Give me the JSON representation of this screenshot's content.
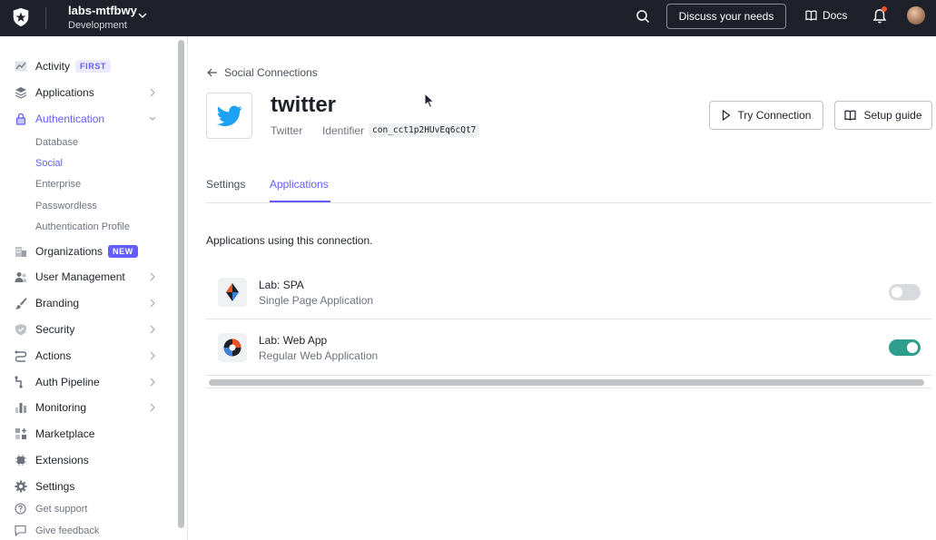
{
  "topbar": {
    "tenant_name": "labs-mtfbwy",
    "tenant_env": "Development",
    "discuss_label": "Discuss your needs",
    "docs_label": "Docs",
    "bell_has_notification": true
  },
  "sidebar": {
    "items": [
      {
        "label": "Activity",
        "icon": "activity-icon",
        "badge": "FIRST"
      },
      {
        "label": "Applications",
        "icon": "layers-icon"
      },
      {
        "label": "Authentication",
        "icon": "lock-icon",
        "active": true,
        "expanded": true
      },
      {
        "label": "Organizations",
        "icon": "building-icon",
        "badge": "NEW"
      },
      {
        "label": "User Management",
        "icon": "users-icon"
      },
      {
        "label": "Branding",
        "icon": "brush-icon"
      },
      {
        "label": "Security",
        "icon": "shield-icon"
      },
      {
        "label": "Actions",
        "icon": "flow-icon"
      },
      {
        "label": "Auth Pipeline",
        "icon": "pipeline-icon"
      },
      {
        "label": "Monitoring",
        "icon": "bar-chart-icon"
      },
      {
        "label": "Marketplace",
        "icon": "plus-grid-icon"
      },
      {
        "label": "Extensions",
        "icon": "chip-icon"
      },
      {
        "label": "Settings",
        "icon": "gear-icon"
      }
    ],
    "auth_sub_items": [
      "Database",
      "Social",
      "Enterprise",
      "Passwordless",
      "Authentication Profile"
    ],
    "active_sub_item": "Social",
    "footer": [
      {
        "label": "Get support",
        "icon": "help-circle-icon"
      },
      {
        "label": "Give feedback",
        "icon": "feedback-icon"
      }
    ]
  },
  "main": {
    "back_label": "Social Connections",
    "connection": {
      "title": "twitter",
      "subtitle": "Twitter",
      "identifier_label": "Identifier",
      "identifier_value": "con_cct1p2HUvEq6cQt7"
    },
    "buttons": {
      "try_label": "Try Connection",
      "guide_label": "Setup guide"
    },
    "tabs": [
      {
        "label": "Settings",
        "active": false
      },
      {
        "label": "Applications",
        "active": true
      }
    ],
    "section_description": "Applications using this connection.",
    "applications": [
      {
        "name": "Lab: SPA",
        "type": "Single Page Application",
        "enabled": false
      },
      {
        "name": "Lab: Web App",
        "type": "Regular Web Application",
        "enabled": true
      }
    ]
  },
  "colors": {
    "accent": "#635dff",
    "toggle_on": "#2f9e8f",
    "topbar_bg": "#1e212a",
    "twitter_blue": "#1da1f2"
  }
}
